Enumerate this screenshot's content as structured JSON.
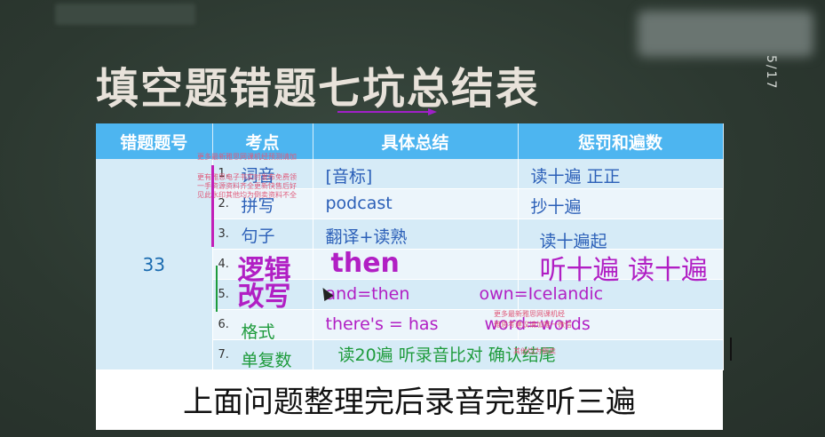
{
  "page_number": "5/17",
  "title": "填空题错题七坑总结表",
  "table": {
    "headers": [
      "错题题号",
      "考点",
      "具体总结",
      "惩罚和遍数"
    ],
    "error_id": "33",
    "rows": [
      {
        "num": "1.",
        "point": "词音",
        "summary": "[音标]",
        "penalty": "读十遍  正正"
      },
      {
        "num": "2.",
        "point": "拼写",
        "summary": "podcast",
        "penalty": "抄十遍"
      },
      {
        "num": "3.",
        "point": "句子",
        "summary": "翻译+读熟",
        "penalty": "读十遍起"
      },
      {
        "num": "4.",
        "point": "逻辑",
        "summary": "then",
        "penalty": "听十遍 读十遍"
      },
      {
        "num": "5.",
        "point": "改写",
        "summary": "and=then",
        "penalty": "own=Icelandic"
      },
      {
        "num": "6.",
        "point": "格式",
        "summary": "there's = has",
        "penalty": "word=words"
      },
      {
        "num": "7.",
        "point": "单复数",
        "summary": "读20遍 听录音比对 确认结尾",
        "penalty": ""
      }
    ]
  },
  "watermarks": {
    "w1": "更多最新雅思网课机经预测请加",
    "w2": "更有雅思电子书实时发布免费领",
    "w3": "一手资源资料齐全更新快售后好",
    "w4": "见此水印其他均为倒卖资料不全",
    "w5": "更多最新雅思网课机经",
    "w6": "雅思考建议请加唯一微信",
    "w7": "其他均为倒卖"
  },
  "caption": "上面问题整理完后录音完整听三遍",
  "colors": {
    "header_blue": "#4db5f0",
    "row_light": "#d6ebf7",
    "annotation_purple": "#b11fc4",
    "annotation_green": "#1e9b3c",
    "text_blue": "#2c60b8"
  }
}
